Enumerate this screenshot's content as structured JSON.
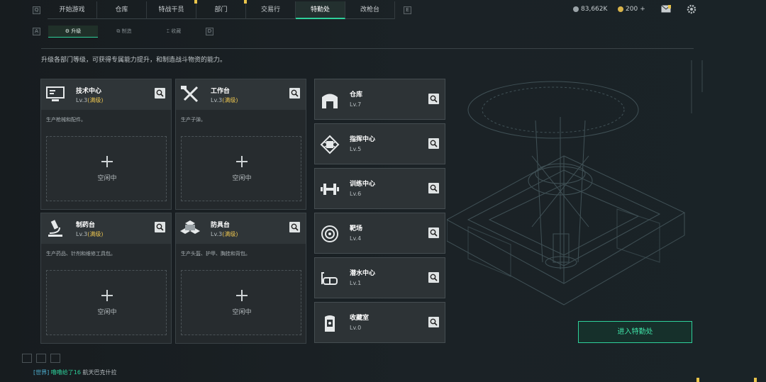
{
  "top_nav": {
    "left_key": "Q",
    "right_key": "E",
    "tabs": [
      {
        "label": "开始游戏"
      },
      {
        "label": "仓库"
      },
      {
        "label": "特战干员"
      },
      {
        "label": "部门"
      },
      {
        "label": "交易行"
      },
      {
        "label": "特勤处",
        "active": true
      },
      {
        "label": "改枪台"
      }
    ]
  },
  "resources": {
    "currency": "83,662K",
    "coins": "200",
    "plus": "+"
  },
  "sub_nav": {
    "left_key": "A",
    "right_key": "D",
    "tabs": [
      {
        "label": "升级",
        "active": true
      },
      {
        "label": "制造"
      },
      {
        "label": "收藏"
      }
    ]
  },
  "description": "升级各部门等级，可获得专属能力提升，和制造战斗物资的能力。",
  "production_cards": [
    {
      "name": "技术中心",
      "level": "Lv.3",
      "max": "(满级)",
      "desc": "生产枪械和配件。",
      "slot": "空闲中",
      "icon": "computer-icon"
    },
    {
      "name": "工作台",
      "level": "Lv.3",
      "max": "(满级)",
      "desc": "生产子弹。",
      "slot": "空闲中",
      "icon": "tools-icon"
    },
    {
      "name": "制药台",
      "level": "Lv.3",
      "max": "(满级)",
      "desc": "生产药品、针剂和维修工具包。",
      "slot": "空闲中",
      "icon": "microscope-icon"
    },
    {
      "name": "防具台",
      "level": "Lv.3",
      "max": "(满级)",
      "desc": "生产头盔、护甲、胸挂和背包。",
      "slot": "空闲中",
      "icon": "armor-cubes-icon"
    }
  ],
  "facilities": [
    {
      "name": "仓库",
      "level": "Lv.7",
      "icon": "warehouse-icon"
    },
    {
      "name": "指挥中心",
      "level": "Lv.5",
      "icon": "chip-icon"
    },
    {
      "name": "训练中心",
      "level": "Lv.6",
      "icon": "dumbbell-icon"
    },
    {
      "name": "靶场",
      "level": "Lv.4",
      "icon": "target-icon"
    },
    {
      "name": "潜水中心",
      "level": "Lv.1",
      "icon": "diving-mask-icon"
    },
    {
      "name": "收藏室",
      "level": "Lv.0",
      "icon": "display-case-icon"
    }
  ],
  "enter_button": "进入特勤处",
  "chat": {
    "channel": "[世界]",
    "user": "噜噜给了16",
    "message": "航天巴克什拉"
  },
  "colors": {
    "accent": "#2ed09a",
    "gold": "#e8c24f",
    "background": "#171c1f"
  }
}
